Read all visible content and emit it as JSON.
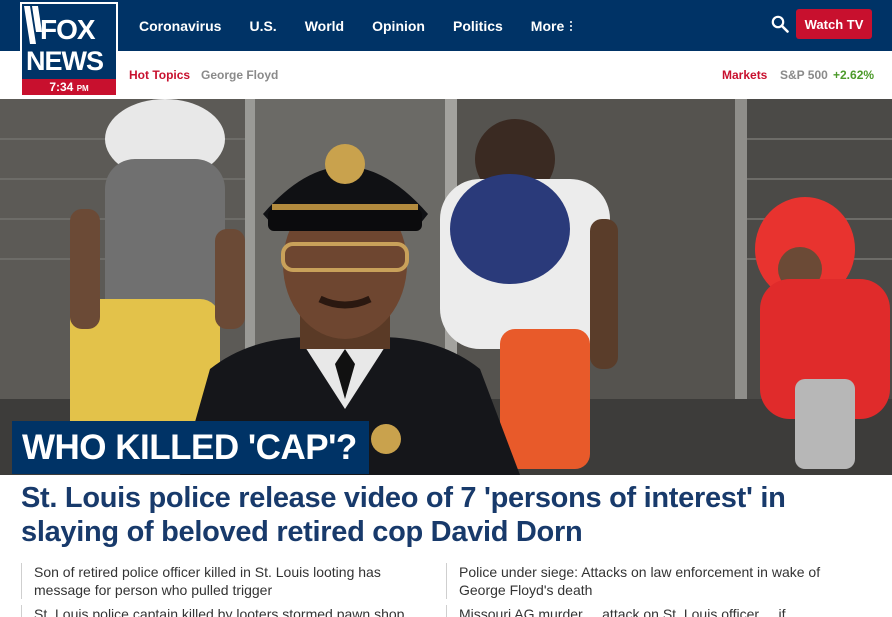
{
  "logo": {
    "line1": "FOX",
    "line2": "NEWS",
    "time": "7:34",
    "ampm": "PM"
  },
  "nav": {
    "items": [
      "Coronavirus",
      "U.S.",
      "World",
      "Opinion",
      "Politics"
    ],
    "more_label": "More",
    "watch_tv_label": "Watch TV"
  },
  "subnav": {
    "hot_topics_label": "Hot Topics",
    "topics": [
      "George Floyd"
    ],
    "markets_label": "Markets",
    "index_name": "S&P 500",
    "index_change": "+2.62%"
  },
  "hero": {
    "kicker": "WHO KILLED 'CAP'?",
    "headline": "St. Louis police release video of 7 'persons of interest' in slaying of beloved retired cop David Dorn"
  },
  "related": [
    "Son of retired police officer killed in St. Louis looting has message for person who pulled trigger",
    "Police under siege: Attacks on law enforcement in wake of George Floyd's death",
    "St. Louis police captain killed by looters stormed pawn shop",
    "Missouri AG murder ... attack on St. Louis officer ... if"
  ],
  "colors": {
    "brand_navy": "#003366",
    "brand_red": "#c8102e",
    "gain_green": "#4c9a2a",
    "headline_blue": "#183a6b"
  }
}
